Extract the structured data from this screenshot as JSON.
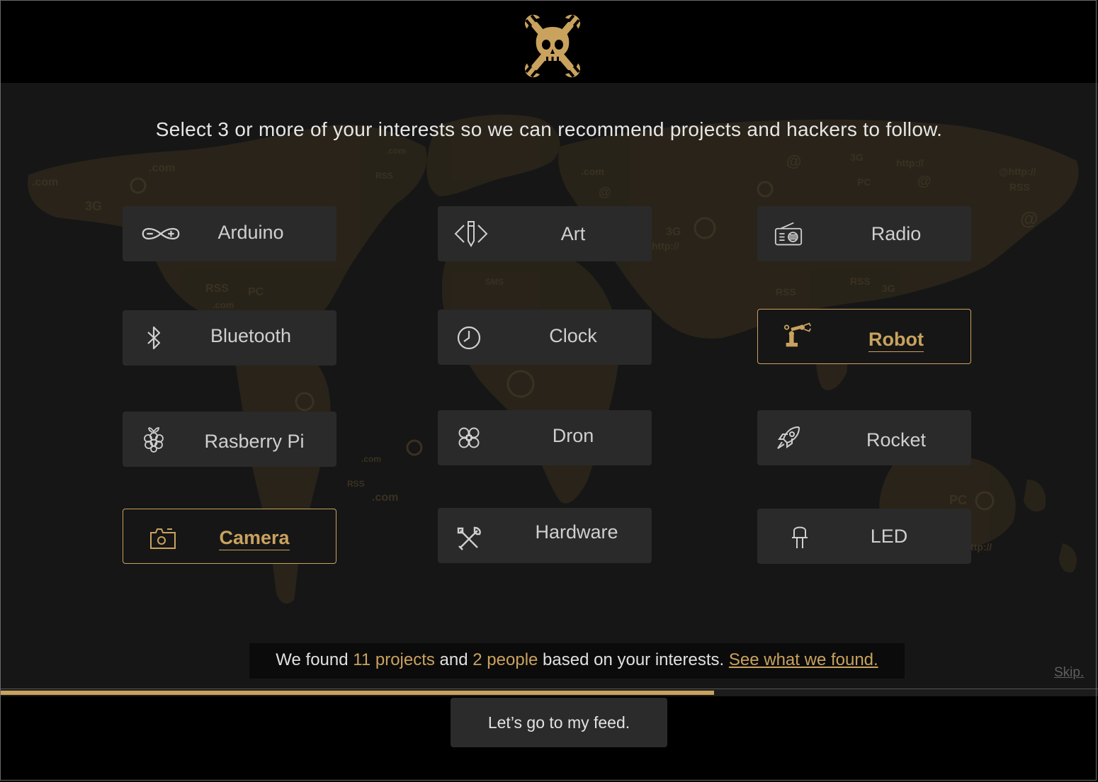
{
  "colors": {
    "accent": "#c9a25e",
    "tile": "#2a2a2a",
    "panel": "#161616",
    "header": "#000000"
  },
  "logo": {
    "icon": "skull-and-wrenches-icon"
  },
  "headline": "Select 3 or more of your interests so we can recommend projects and hackers to follow.",
  "interests": [
    {
      "label": "Arduino",
      "icon": "arduino-icon",
      "selected": false
    },
    {
      "label": "Art",
      "icon": "pencil-art-icon",
      "selected": false
    },
    {
      "label": "Radio",
      "icon": "radio-icon",
      "selected": false
    },
    {
      "label": "Bluetooth",
      "icon": "bluetooth-icon",
      "selected": false
    },
    {
      "label": "Clock",
      "icon": "clock-icon",
      "selected": false
    },
    {
      "label": "Robot",
      "icon": "robot-arm-icon",
      "selected": true
    },
    {
      "label": "Rasberry Pi",
      "icon": "raspberry-pi-icon",
      "selected": false
    },
    {
      "label": "Dron",
      "icon": "drone-icon",
      "selected": false
    },
    {
      "label": "Rocket",
      "icon": "rocket-icon",
      "selected": false
    },
    {
      "label": "Camera",
      "icon": "camera-icon",
      "selected": true
    },
    {
      "label": "Hardware",
      "icon": "tools-icon",
      "selected": false
    },
    {
      "label": "LED",
      "icon": "led-icon",
      "selected": false
    }
  ],
  "found": {
    "prefix": "We found ",
    "projects": "11 projects",
    "middle": " and ",
    "people": "2 people",
    "suffix": " based on your interests.",
    "link": "See what we found."
  },
  "skip": "Skip.",
  "progress": 0.65,
  "cta": "Let’s go to my feed."
}
